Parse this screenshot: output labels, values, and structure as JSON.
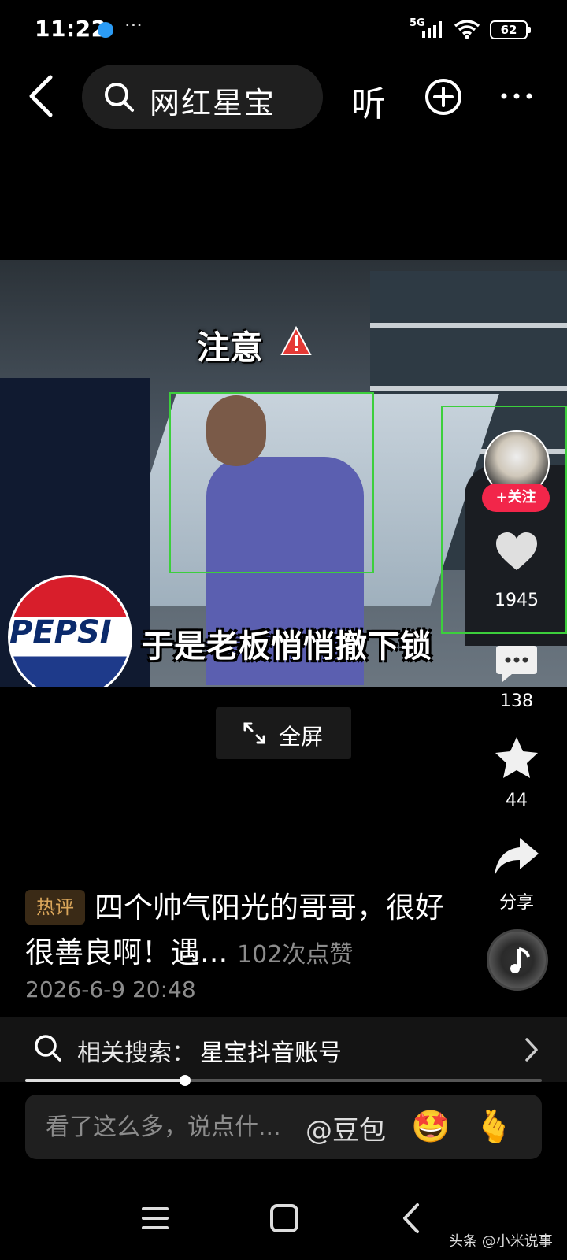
{
  "status_bar": {
    "time": "11:22",
    "dots": "···",
    "network": "5G",
    "battery": "62"
  },
  "top_nav": {
    "search_text": "网红星宝",
    "listen_label": "听"
  },
  "video": {
    "notice": "注意",
    "subtitle": "于是老板悄悄撤下锁",
    "brand_text": "PEPSI"
  },
  "rail": {
    "follow_label": "+关注",
    "like_count": "1945",
    "comment_count": "138",
    "favorite_count": "44",
    "share_label": "分享"
  },
  "fullscreen": {
    "label": "全屏"
  },
  "hot_comment": {
    "badge": "热评",
    "text": "四个帅气阳光的哥哥，很好很善良啊！遇...",
    "likes": "102次点赞",
    "timestamp": "2026-6-9 20:48"
  },
  "related_search": {
    "label": "相关搜索：",
    "value": "星宝抖音账号"
  },
  "progress": {
    "fraction": 0.31
  },
  "comment_input": {
    "placeholder": "看了这么多，说点什...",
    "mention": "@豆包"
  },
  "watermark": "头条 @小米说事",
  "colors": {
    "follow_red": "#f2264a",
    "hot_badge_text": "#d9a55a",
    "background": "#000000"
  }
}
